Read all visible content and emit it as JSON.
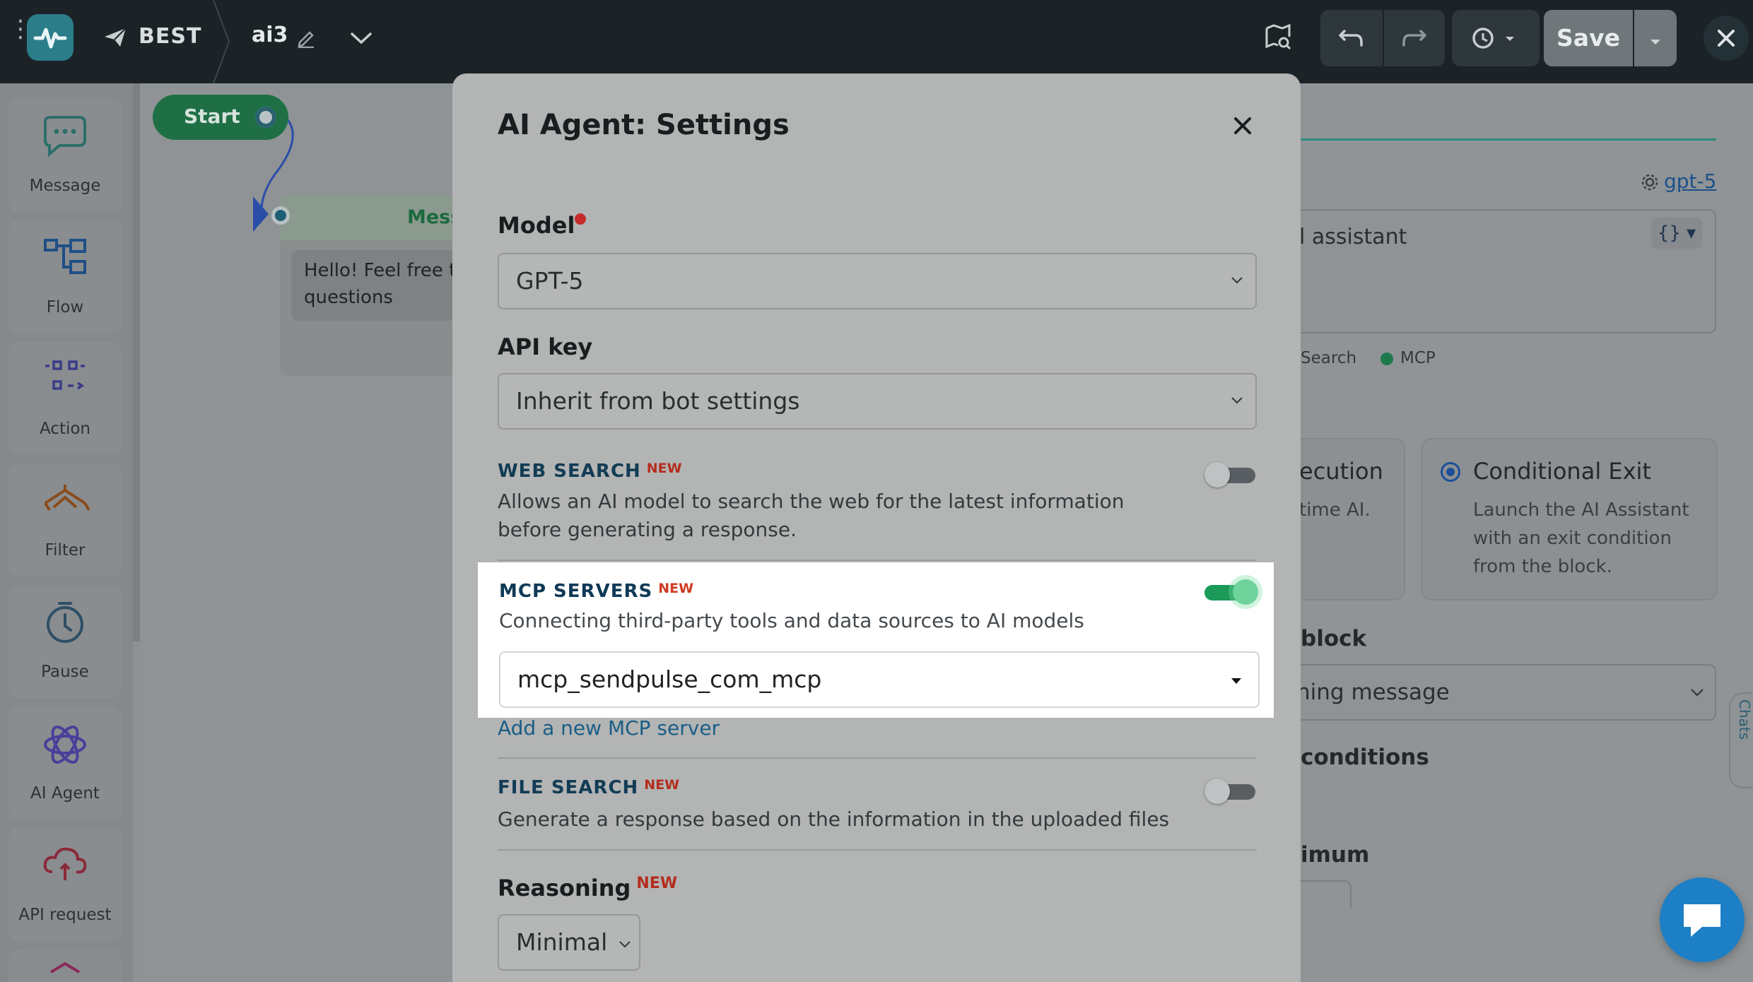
{
  "topbar": {
    "bot_name": "BEST",
    "flow_name": "ai3",
    "save_label": "Save"
  },
  "sidebar": {
    "items": [
      {
        "label": "Message",
        "icon": "message-icon"
      },
      {
        "label": "Flow",
        "icon": "flow-icon"
      },
      {
        "label": "Action",
        "icon": "action-icon"
      },
      {
        "label": "Filter",
        "icon": "filter-icon"
      },
      {
        "label": "Pause",
        "icon": "pause-icon"
      },
      {
        "label": "AI Agent",
        "icon": "ai-agent-icon"
      },
      {
        "label": "API request",
        "icon": "api-request-icon"
      }
    ]
  },
  "canvas": {
    "start_label": "Start",
    "message_node_title": "Mess",
    "message_node_text": "Hello! Feel free t questions"
  },
  "right_panel": {
    "model_link": "gpt-5",
    "prompt_fragment": "l assistant",
    "braces": "{}",
    "tags": [
      "Search",
      "MCP"
    ],
    "card_execution_title": "ecution",
    "card_execution_desc": "time AI.",
    "card_conditional_title": "Conditional Exit",
    "card_conditional_desc": "Launch the AI Assistant with an exit condition from the block.",
    "block_heading": "block",
    "block_select": "ning message",
    "conditions_heading": "conditions",
    "minimum_heading": "imum",
    "side_tab": "Chats"
  },
  "modal": {
    "title": "AI Agent: Settings",
    "model_label": "Model",
    "model_value": "GPT-5",
    "api_key_label": "API key",
    "api_key_value": "Inherit from bot settings",
    "new_badge": "NEW",
    "web_search": {
      "title": "WEB SEARCH",
      "desc": "Allows an AI model to search the web for the latest information before generating a response.",
      "enabled": false
    },
    "mcp": {
      "title": "MCP SERVERS",
      "desc": "Connecting third-party tools and data sources to AI models",
      "enabled": true,
      "server": "mcp_sendpulse_com_mcp",
      "add_link": "Add a new MCP server"
    },
    "file_search": {
      "title": "FILE SEARCH",
      "desc": "Generate a response based on the information in the uploaded files",
      "enabled": false
    },
    "reasoning_label": "Reasoning",
    "reasoning_value": "Minimal"
  },
  "colors": {
    "topbar": "#1b2327",
    "accent_green": "#1b9a5a",
    "badge_red": "#b42d1e",
    "link_blue": "#1a5e86",
    "chat_blue": "#1d7fc5"
  }
}
